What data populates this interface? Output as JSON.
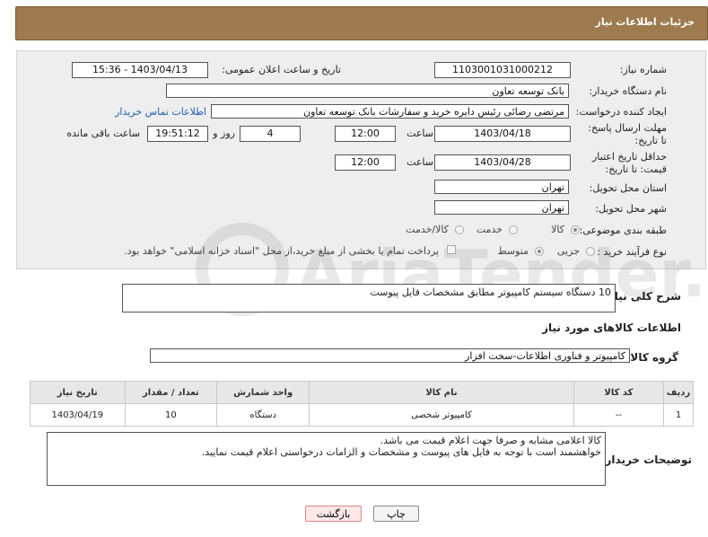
{
  "header": {
    "title": "جزئیات اطلاعات نیاز"
  },
  "labels": {
    "need_number": "شماره نیاز:",
    "announce_datetime": "تاریخ و ساعت اعلان عمومی:",
    "buyer_org": "نام دستگاه خریدار:",
    "creator": "ایجاد کننده درخواست:",
    "reply_deadline": "مهلت ارسال پاسخ: تا تاریخ:",
    "price_validity": "حداقل تاریخ اعتبار قیمت: تا تاریخ:",
    "hour": "ساعت",
    "day_and": "روز و",
    "hours_remaining": "ساعت باقی مانده",
    "province": "استان محل تحویل:",
    "city": "شهر محل تحویل:",
    "category": "طبقه بندی موضوعی:",
    "purchase_type": "نوع فرآیند خرید :",
    "general_desc": "شرح کلی نیاز:",
    "goods_info": "اطلاعات کالاهای مورد نیاز",
    "goods_group": "گروه کالا:",
    "buyer_notes": "توضیحات خریدار:"
  },
  "values": {
    "need_number": "1103001031000212",
    "announce_datetime": "1403/04/13 - 15:36",
    "buyer_org": "بانک توسعه تعاون",
    "creator": "مرتضی رضائی رئیس دایره خرید و سفارشات بانک توسعه تعاون",
    "contact_link": "اطلاعات تماس خریدار",
    "reply_date": "1403/04/18",
    "reply_time": "12:00",
    "days": "4",
    "remaining_time": "19:51:12",
    "validity_date": "1403/04/28",
    "validity_time": "12:00",
    "province": "تهران",
    "city": "تهران",
    "general_desc": "10 دستگاه سیستم کامپیوتر مطابق مشخصات فایل پیوست",
    "goods_group": "کامپیوتر و فناوری اطلاعات-سخت افزار",
    "buyer_notes": "کالا اعلامی مشابه و صرفا جهت اعلام قیمت می باشد.\nخواهشمند است با توجه به فایل های پیوست و مشخصات و الزامات درخواستی اعلام قیمت نمایید."
  },
  "category_options": [
    {
      "label": "کالا",
      "selected": true
    },
    {
      "label": "خدمت",
      "selected": false
    },
    {
      "label": "کالا/خدمت",
      "selected": false
    }
  ],
  "purchase_options": [
    {
      "label": "جزیی",
      "selected": false
    },
    {
      "label": "متوسط",
      "selected": true
    }
  ],
  "payment_note": "پرداخت تمام یا بخشی از مبلغ خرید،از محل \"اسناد خزانه اسلامی\" خواهد بود.",
  "table": {
    "headers": [
      "ردیف",
      "کد کالا",
      "نام کالا",
      "واحد شمارش",
      "تعداد / مقدار",
      "تاریخ نیاز"
    ],
    "rows": [
      [
        "1",
        "--",
        "کامپیوتر شخصی",
        "دستگاه",
        "10",
        "1403/04/19"
      ]
    ]
  },
  "buttons": {
    "print": "چاپ",
    "back": "بازگشت"
  },
  "watermark": {
    "text": "AriaTender.neT"
  }
}
